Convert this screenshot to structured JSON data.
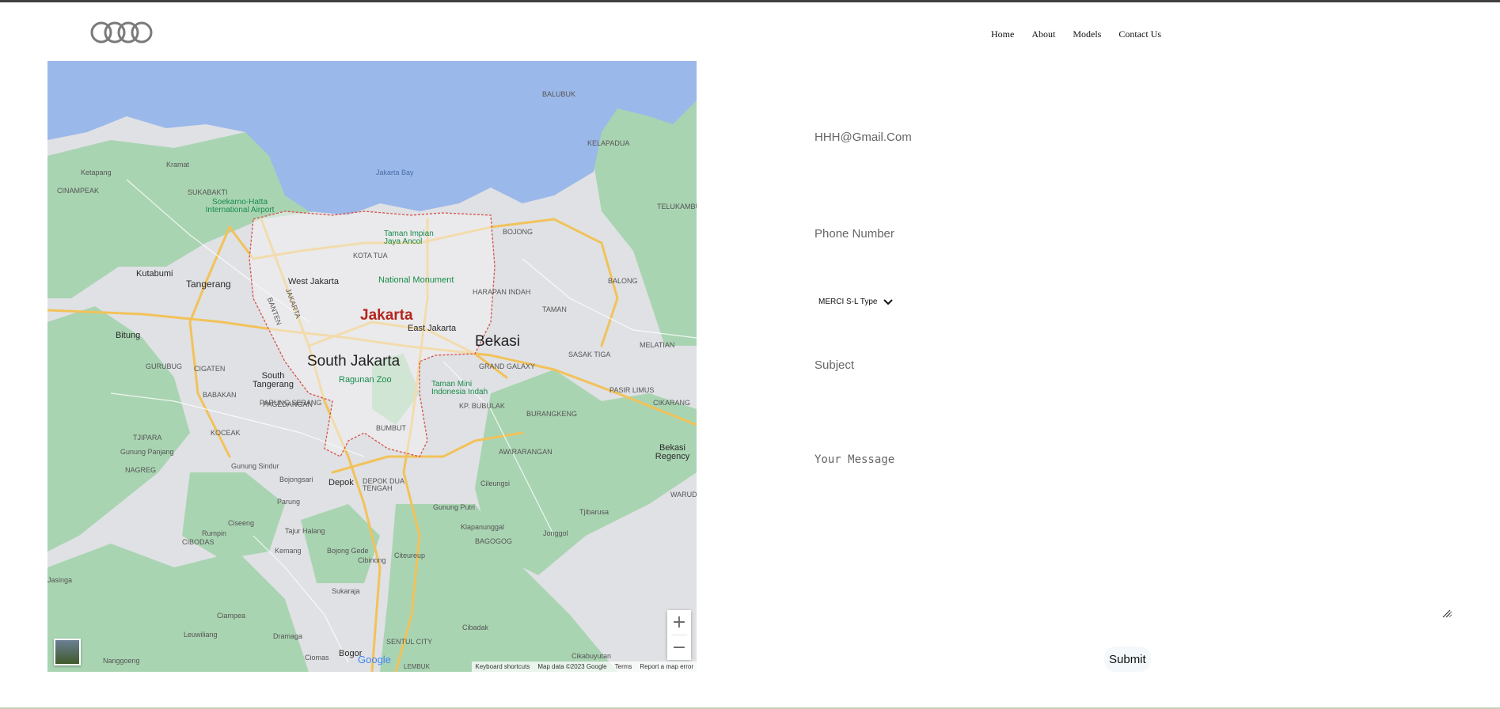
{
  "nav": {
    "items": [
      "Home",
      "About",
      "Models",
      "Contact Us"
    ]
  },
  "map": {
    "water_label": "Jakarta Bay",
    "places_small": [
      "BALUBUK",
      "KELAPADUA",
      "Ketapang",
      "Kramat",
      "SUKABAKTI",
      "CINAMPEAK",
      "TELUKAMBULU",
      "BOJONG",
      "BALONG",
      "TAMAN",
      "MELATIAN",
      "SASAK TIGA",
      "GRAND GALAXY",
      "PASIR LIMUS",
      "CIKARANG",
      "BURANGKENG",
      "AWIRARANGAN",
      "WARUDO",
      "GURUBUG",
      "CIGATEN",
      "BABAKAN",
      "PARUNG SERANG",
      "KOCEAK",
      "TJIPARA",
      "NAGREG",
      "KOTA TUA",
      "HARAPAN INDAH",
      "BUMBUT",
      "DEPOK DUA TENGAH",
      "BAGOGOG",
      "CIBODAS",
      "SENTUL CITY",
      "LEMBUK",
      "BANTEN",
      "JAKARTA",
      "PAGEDANGAN",
      "KP. BUBULAK"
    ],
    "places_medium": [
      "Kutabumi",
      "Tangerang",
      "Bitung",
      "West Jakarta",
      "East Jakarta",
      "South Tangerang",
      "Gunung Sindur",
      "Gunung Panjang",
      "Bojongsari",
      "Depok",
      "Parung",
      "Ciseeng",
      "Rumpin",
      "Tajur Halang",
      "Kemang",
      "Bojong Gede",
      "Cibinong",
      "Citeureup",
      "Sukaraja",
      "Ciampea",
      "Dramaga",
      "Leuwiliang",
      "Ciomas",
      "Nanggoeng",
      "Jasinga",
      "Gunung Putri",
      "Klapanunggal",
      "Jonggol",
      "Tjibarusa",
      "Cileungsi",
      "Cibadak",
      "Cikabuyutan",
      "Bekasi Regency"
    ],
    "places_large": [
      "South Jakarta",
      "Bekasi"
    ],
    "city": "Jakarta",
    "pois": [
      "Soekarno-Hatta International Airport",
      "Taman Impian Jaya Ancol",
      "National Monument",
      "Ragunan Zoo",
      "Taman Mini Indonesia Indah"
    ],
    "brand": "Google",
    "attribution": [
      "Keyboard shortcuts",
      "Map data ©2023 Google",
      "Terms",
      "Report a map error"
    ],
    "zoom_in": "+",
    "zoom_out": "−",
    "partial": "Bogor"
  },
  "form": {
    "email_placeholder": "HHH@Gmail.Com",
    "phone_placeholder": "Phone Number",
    "select_value": "MERCI S-L Type",
    "subject_placeholder": "Subject",
    "message_placeholder": "Your Message",
    "submit_label": "Submit"
  },
  "colors": {
    "water": "#9bb8ea",
    "land": "#dfe1e4",
    "green": "#a9d4b2",
    "road": "#f2c25a",
    "city_border": "#d6504a",
    "accent_red": "#b3261e"
  }
}
